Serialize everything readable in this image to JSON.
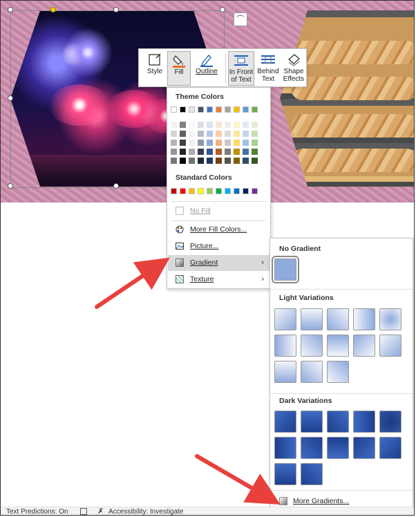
{
  "toolbar": {
    "style": "Style",
    "fill": "Fill",
    "outline": "Outline",
    "in_front_line1": "In Front",
    "in_front_line2": "of Text",
    "behind_line1": "Behind",
    "behind_line2": "Text",
    "shape_effects_line1": "Shape",
    "shape_effects_line2": "Effects"
  },
  "fill_menu": {
    "theme_colors_heading": "Theme Colors",
    "standard_colors_heading": "Standard Colors",
    "theme_top_row": [
      "#ffffff",
      "#000000",
      "#e7e6e6",
      "#44546a",
      "#4472c4",
      "#ed7d31",
      "#a5a5a5",
      "#ffc000",
      "#5b9bd5",
      "#70ad47"
    ],
    "standard_colors": [
      "#c00000",
      "#ff0000",
      "#ffc000",
      "#ffff00",
      "#92d050",
      "#00b050",
      "#00b0f0",
      "#0070c0",
      "#002060",
      "#7030a0"
    ],
    "no_fill": "No Fill",
    "more_fill_colors": "More Fill Colors...",
    "picture": "Picture...",
    "gradient": "Gradient",
    "texture": "Texture"
  },
  "gradient_menu": {
    "no_gradient_heading": "No Gradient",
    "light_variations_heading": "Light Variations",
    "dark_variations_heading": "Dark Variations",
    "more_gradients": "More Gradients...",
    "base_color": "#8faadc",
    "dark_color": "#2f55a4"
  },
  "status_bar": {
    "text_predictions": "Text Predictions: On",
    "accessibility": "Accessibility: Investigate"
  },
  "annotation_color": "#e8403c"
}
